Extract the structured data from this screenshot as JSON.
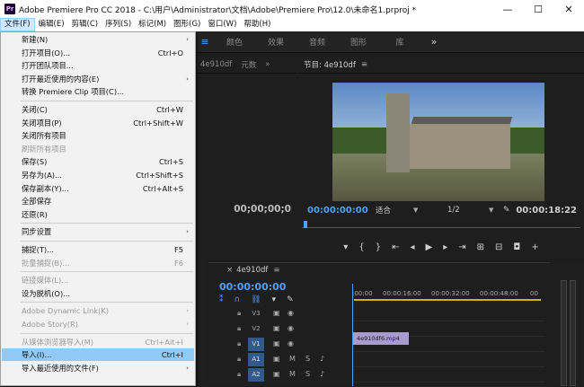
{
  "window": {
    "title": "Adobe Premiere Pro CC 2018 - C:\\用户\\Administrator\\文档\\Adobe\\Premiere Pro\\12.0\\未命名1.prproj *",
    "app_icon_text": "Pr",
    "minimize": "—",
    "maximize": "☐",
    "close": "✕"
  },
  "menubar": [
    "文件(F)",
    "编辑(E)",
    "剪辑(C)",
    "序列(S)",
    "标记(M)",
    "图形(G)",
    "窗口(W)",
    "帮助(H)"
  ],
  "workspaces": [
    "颜色",
    "效果",
    "音频",
    "图形",
    "库"
  ],
  "workspaces_more": "»",
  "source_panel": {
    "tabs": [
      "4e910df",
      "元数"
    ],
    "more": "»",
    "timecode": "00;00;00;0"
  },
  "program_monitor": {
    "title": "节目: 4e910df",
    "timecode_current": "00:00:00:00",
    "fit": "适合",
    "resolution": "1/2",
    "timecode_duration": "00:00:18:22"
  },
  "timeline": {
    "tab": "4e910df",
    "timecode": "00:00:00:00",
    "ruler": [
      ":00:00",
      "00:00:16:00",
      "00:00:32:00",
      "00:00:48:00",
      "00"
    ],
    "tracks": [
      {
        "label": "V3",
        "active": false,
        "type": "video"
      },
      {
        "label": "V2",
        "active": false,
        "type": "video"
      },
      {
        "label": "V1",
        "active": true,
        "type": "video"
      },
      {
        "label": "A1",
        "active": true,
        "type": "audio"
      },
      {
        "label": "A2",
        "active": true,
        "type": "audio"
      }
    ],
    "clip_name": "4e910df6.mp4"
  },
  "file_menu": [
    {
      "label": "新建(N)",
      "shortcut": "",
      "submenu": true,
      "disabled": false
    },
    {
      "label": "打开项目(O)...",
      "shortcut": "Ctrl+O",
      "submenu": false,
      "disabled": false
    },
    {
      "label": "打开团队项目...",
      "shortcut": "",
      "submenu": false,
      "disabled": false
    },
    {
      "label": "打开最近使用的内容(E)",
      "shortcut": "",
      "submenu": true,
      "disabled": false
    },
    {
      "label": "转换 Premiere Clip 项目(C)...",
      "shortcut": "",
      "submenu": false,
      "disabled": false
    },
    {
      "sep": true
    },
    {
      "label": "关闭(C)",
      "shortcut": "Ctrl+W",
      "submenu": false,
      "disabled": false
    },
    {
      "label": "关闭项目(P)",
      "shortcut": "Ctrl+Shift+W",
      "submenu": false,
      "disabled": false
    },
    {
      "label": "关闭所有项目",
      "shortcut": "",
      "submenu": false,
      "disabled": false
    },
    {
      "label": "刷新所有项目",
      "shortcut": "",
      "submenu": false,
      "disabled": true
    },
    {
      "label": "保存(S)",
      "shortcut": "Ctrl+S",
      "submenu": false,
      "disabled": false
    },
    {
      "label": "另存为(A)...",
      "shortcut": "Ctrl+Shift+S",
      "submenu": false,
      "disabled": false
    },
    {
      "label": "保存副本(Y)...",
      "shortcut": "Ctrl+Alt+S",
      "submenu": false,
      "disabled": false
    },
    {
      "label": "全部保存",
      "shortcut": "",
      "submenu": false,
      "disabled": false
    },
    {
      "label": "还原(R)",
      "shortcut": "",
      "submenu": false,
      "disabled": false
    },
    {
      "sep": true
    },
    {
      "label": "同步设置",
      "shortcut": "",
      "submenu": true,
      "disabled": false
    },
    {
      "sep": true
    },
    {
      "label": "捕捉(T)...",
      "shortcut": "F5",
      "submenu": false,
      "disabled": false
    },
    {
      "label": "批量捕捉(B)...",
      "shortcut": "F6",
      "submenu": false,
      "disabled": true
    },
    {
      "sep": true
    },
    {
      "label": "链接媒体(L)...",
      "shortcut": "",
      "submenu": false,
      "disabled": true
    },
    {
      "label": "设为脱机(O)...",
      "shortcut": "",
      "submenu": false,
      "disabled": false
    },
    {
      "sep": true
    },
    {
      "label": "Adobe Dynamic Link(K)",
      "shortcut": "",
      "submenu": true,
      "disabled": true
    },
    {
      "label": "Adobe Story(R)",
      "shortcut": "",
      "submenu": true,
      "disabled": true
    },
    {
      "sep": true
    },
    {
      "label": "从媒体浏览器导入(M)",
      "shortcut": "Ctrl+Alt+I",
      "submenu": false,
      "disabled": true
    },
    {
      "label": "导入(I)...",
      "shortcut": "Ctrl+I",
      "submenu": false,
      "disabled": false,
      "highlight": true
    },
    {
      "label": "导入最近使用的文件(F)",
      "shortcut": "",
      "submenu": true,
      "disabled": false
    }
  ]
}
